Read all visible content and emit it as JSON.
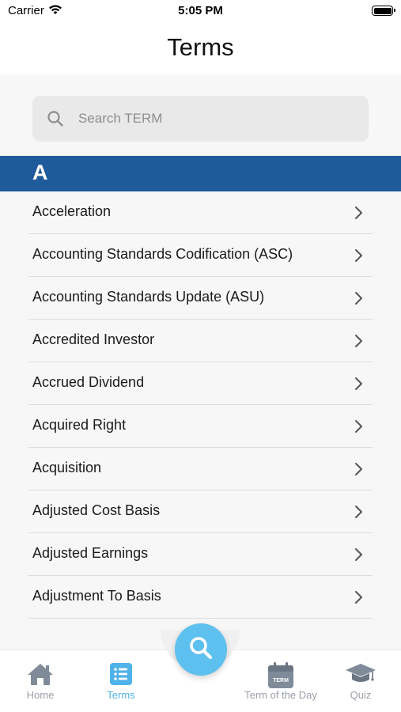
{
  "status_bar": {
    "carrier": "Carrier",
    "time": "5:05 PM"
  },
  "nav": {
    "title": "Terms"
  },
  "search": {
    "placeholder": "Search TERM"
  },
  "section": {
    "letter": "A"
  },
  "terms": [
    {
      "label": "Acceleration"
    },
    {
      "label": "Accounting Standards Codification (ASC)"
    },
    {
      "label": "Accounting Standards Update (ASU)"
    },
    {
      "label": "Accredited Investor"
    },
    {
      "label": "Accrued Dividend"
    },
    {
      "label": "Acquired Right"
    },
    {
      "label": "Acquisition"
    },
    {
      "label": "Adjusted Cost Basis"
    },
    {
      "label": "Adjusted Earnings"
    },
    {
      "label": "Adjustment To Basis"
    }
  ],
  "tab_bar": {
    "home": {
      "label": "Home",
      "icon": "home-icon"
    },
    "terms": {
      "label": "Terms",
      "icon": "list-icon",
      "active": true
    },
    "search": {
      "icon": "search-icon"
    },
    "term_of_day": {
      "label": "Term of the Day",
      "icon": "calendar-icon",
      "calendar_text": "TERM"
    },
    "quiz": {
      "label": "Quiz",
      "icon": "graduation-cap-icon"
    }
  },
  "colors": {
    "section_header": "#1f5a9a",
    "accent": "#4fb2e8",
    "fab": "#5ec0ee",
    "tab_inactive": "#9aa0a8"
  }
}
